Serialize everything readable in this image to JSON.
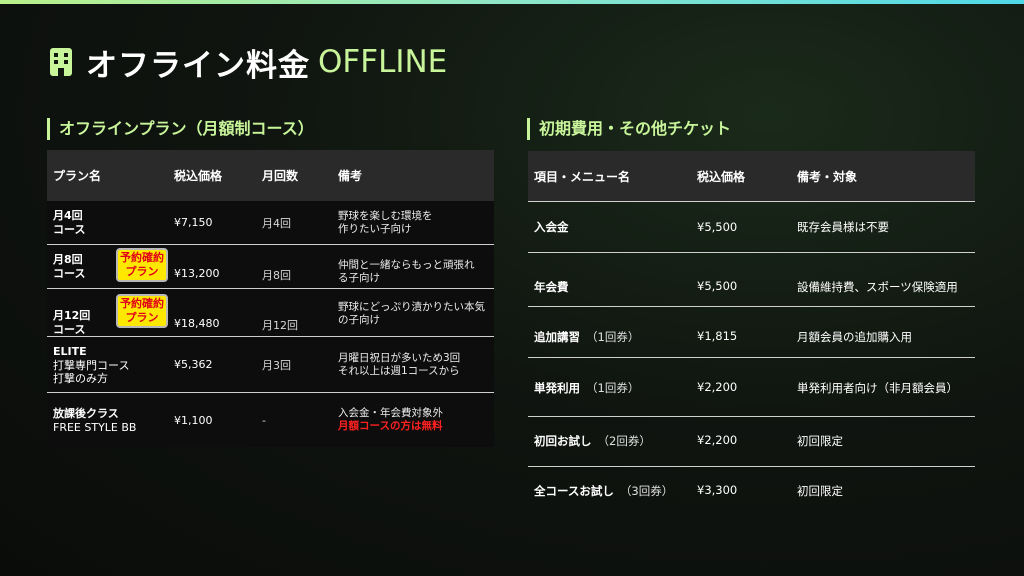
{
  "header": {
    "title": "オフライン料金",
    "title_en": "OFFLINE",
    "icon": "building-icon",
    "accent_color": "#c8f59a"
  },
  "left_section": {
    "title": "オフラインプラン（月額制コース）",
    "columns": [
      "プラン名",
      "税込価格",
      "月回数",
      "備考"
    ],
    "rows": [
      {
        "name_line1": "月4回",
        "name_line2": "コース",
        "price": "¥7,150",
        "count": "月4回",
        "note_line1": "野球を楽しむ環境を",
        "note_line2": "作りたい子向け"
      },
      {
        "name_line1": "月8回",
        "name_line2": "コース",
        "badge_line1": "予約確約",
        "badge_line2": "プラン",
        "price": "¥13,200",
        "count": "月8回",
        "note_line1": "仲間と一緒ならもっと頑張れ",
        "note_line2": "る子向け"
      },
      {
        "name_line1": "月12回",
        "name_line2": "コース",
        "badge_line1": "予約確約",
        "badge_line2": "プラン",
        "price": "¥18,480",
        "count": "月12回",
        "note_line1": "野球にどっぷり漬かりたい本気",
        "note_line2": "の子向け"
      },
      {
        "name_line1": "ELITE",
        "name_line2": "打撃専門コース",
        "name_line3": "打撃のみ方",
        "price": "¥5,362",
        "count": "月3回",
        "note_line1": "月曜日祝日が多いため3回",
        "note_line2": "それ以上は週1コースから"
      },
      {
        "name_line1": "放課後クラス",
        "name_line2": "FREE STYLE BB",
        "price": "¥1,100",
        "count": "-",
        "note_line1": "入会金・年会費対象外",
        "note_line2": "月額コースの方は無料"
      }
    ]
  },
  "right_section": {
    "title": "初期費用・その他チケット",
    "columns": [
      "項目・メニュー名",
      "税込価格",
      "備考・対象"
    ],
    "rows": [
      {
        "name": "入会金",
        "sub": "",
        "price": "¥5,500",
        "note": "既存会員様は不要"
      },
      {
        "name": "年会費",
        "sub": "",
        "price": "¥5,500",
        "note": "設備維持費、スポーツ保険適用"
      },
      {
        "name": "追加講習",
        "sub": "（1回券）",
        "price": "¥1,815",
        "note": "月額会員の追加購入用"
      },
      {
        "name": "単発利用",
        "sub": "（1回券）",
        "price": "¥2,200",
        "note": "単発利用者向け（非月額会員）"
      },
      {
        "name": "初回お試し",
        "sub": "（2回券）",
        "price": "¥2,200",
        "note": "初回限定"
      },
      {
        "name": "全コースお試し",
        "sub": "（3回券）",
        "price": "¥3,300",
        "note": "初回限定"
      }
    ]
  }
}
